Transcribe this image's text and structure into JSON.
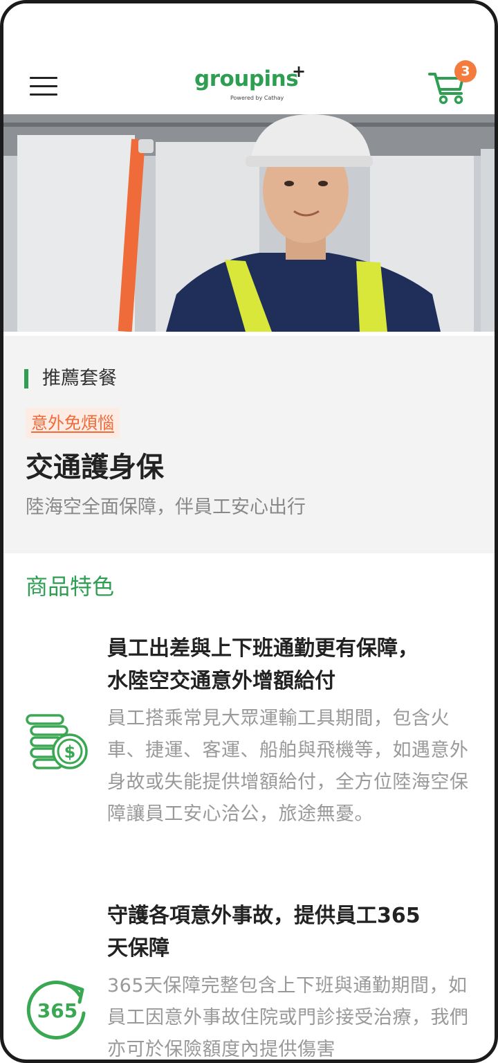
{
  "header": {
    "logo_word": "groupins",
    "logo_plus": "+",
    "logo_sub": "Powered by Cathay",
    "cart_count": "3"
  },
  "colors": {
    "brand_green": "#2e9e52",
    "accent_orange": "#f47b3e",
    "tag_text": "#f06a3a"
  },
  "recommend": {
    "section_label": "推薦套餐",
    "tag": "意外免煩惱",
    "plan_title": "交通護身保",
    "plan_subtitle": "陸海空全面保障，伴員工安心出行"
  },
  "features": {
    "title": "商品特色",
    "items": [
      {
        "icon": "coins-dollar-icon",
        "heading_line1": "員工出差與上下班通勤更有保障，",
        "heading_line2": "水陸空交通意外增額給付",
        "body": "員工搭乘常見大眾運輸工具期間，包含火車、捷運、客運、船舶與飛機等，如遇意外身故或失能提供增額給付，全方位陸海空保障讓員工安心洽公，旅途無憂。"
      },
      {
        "icon": "365-cycle-icon",
        "icon_text": "365",
        "heading_line1": "守護各項意外事故，提供員工365",
        "heading_line2": "天保障",
        "body": "365天保障完整包含上下班與通勤期間，如員工因意外事故住院或門診接受治療，我們亦可於保險額度內提供傷害"
      }
    ]
  }
}
